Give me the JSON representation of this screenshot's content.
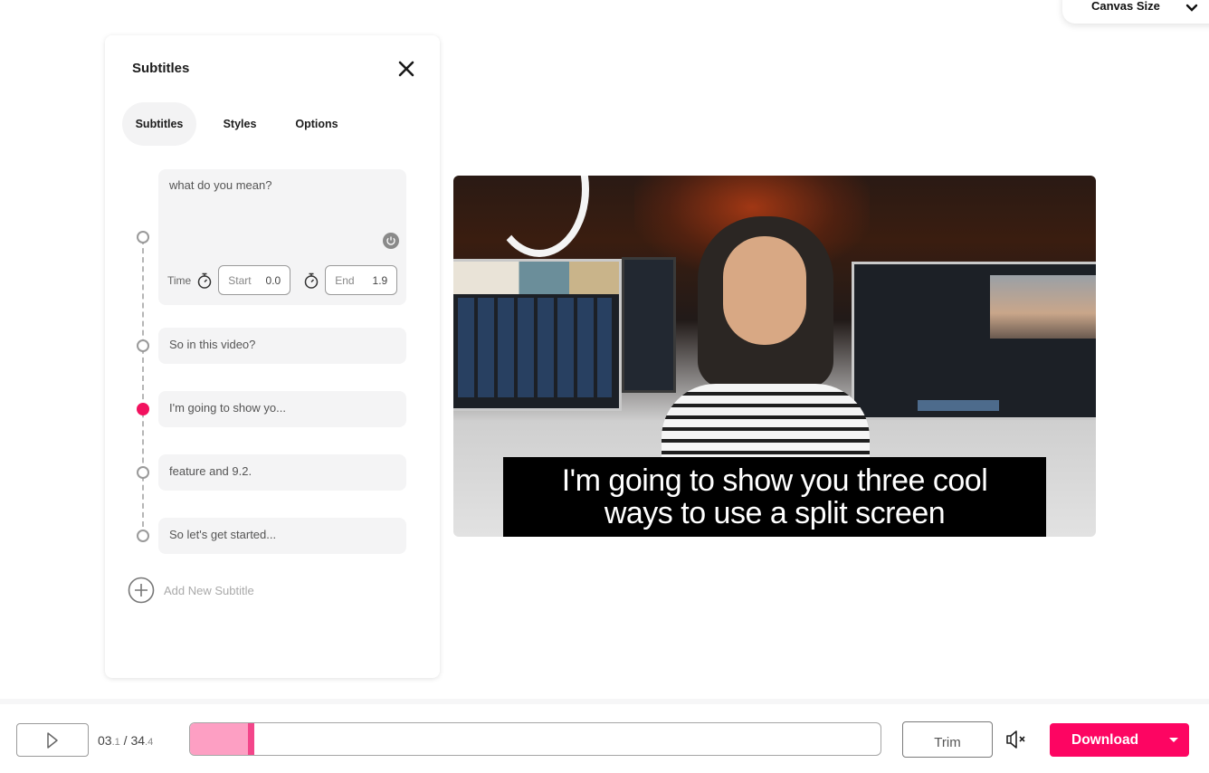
{
  "canvas_size": {
    "label": "Canvas Size",
    "icon": "chevron-down-icon"
  },
  "panel": {
    "title": "Subtitles",
    "close_icon": "close-icon",
    "tabs": [
      {
        "label": "Subtitles",
        "active": true
      },
      {
        "label": "Styles",
        "active": false
      },
      {
        "label": "Options",
        "active": false
      }
    ],
    "subtitles": [
      {
        "text": "what do you mean?",
        "expanded": true,
        "start": "0.0",
        "end": "1.9",
        "active": false
      },
      {
        "text": "So in this video?",
        "expanded": false,
        "active": false
      },
      {
        "text": "I'm going to show yo...",
        "expanded": false,
        "active": true
      },
      {
        "text": "feature and 9.2.",
        "expanded": false,
        "active": false
      },
      {
        "text": "So let's get started...",
        "expanded": false,
        "active": false
      }
    ],
    "time_label": "Time",
    "start_placeholder": "Start",
    "end_placeholder": "End",
    "add_label": "Add New Subtitle"
  },
  "video": {
    "caption_line1": "I'm going to show you three cool",
    "caption_line2": "ways to use a split screen"
  },
  "player": {
    "current_time": "03",
    "current_time_frac": ".1",
    "separator": " / ",
    "total_time": "34",
    "total_time_frac": ".4",
    "progress_fraction": 0.09,
    "trim_label": "Trim",
    "download_label": "Download",
    "accent_color": "#fd0562",
    "progress_fill_color": "#fd9fc3"
  }
}
